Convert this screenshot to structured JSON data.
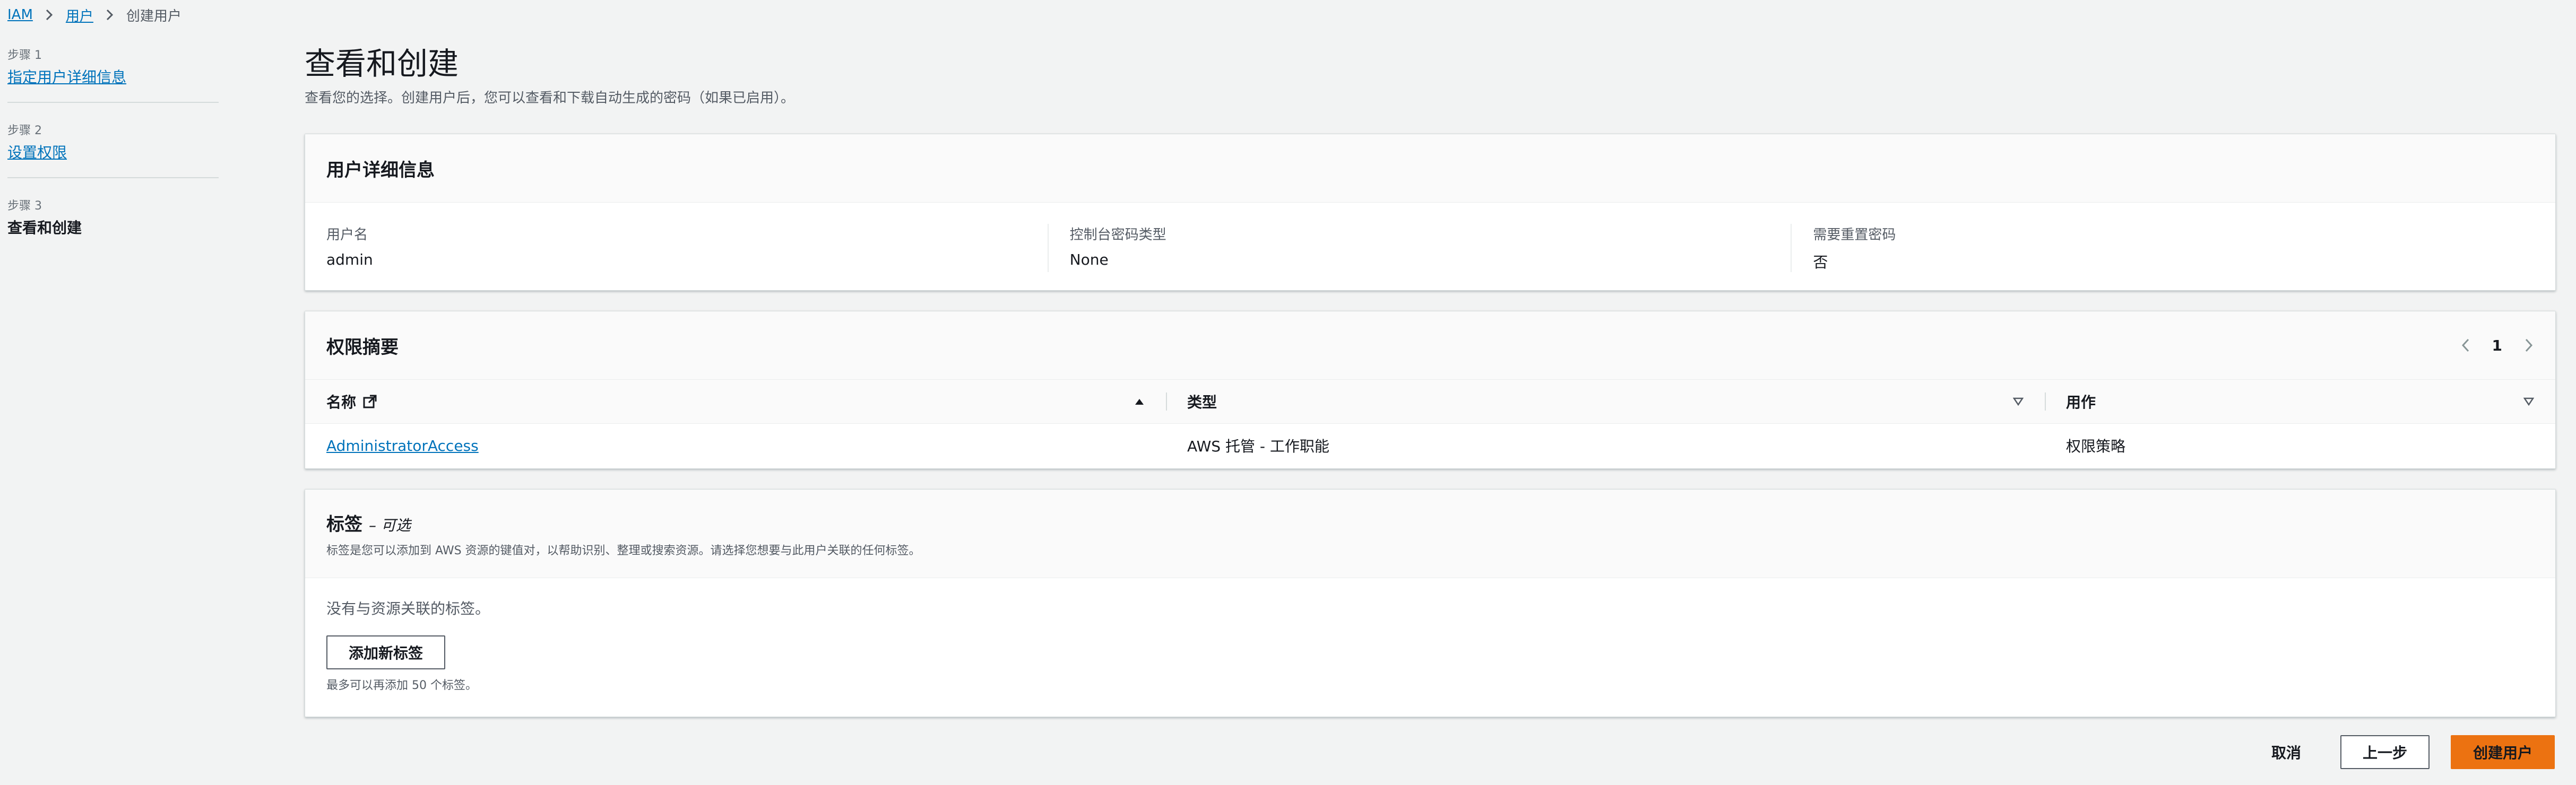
{
  "breadcrumb": {
    "root": "IAM",
    "parent": "用户",
    "current": "创建用户"
  },
  "steps": [
    {
      "caption": "步骤 1",
      "label": "指定用户详细信息"
    },
    {
      "caption": "步骤 2",
      "label": "设置权限"
    },
    {
      "caption": "步骤 3",
      "label": "查看和创建"
    }
  ],
  "header": {
    "title": "查看和创建",
    "description": "查看您的选择。创建用户后，您可以查看和下载自动生成的密码（如果已启用）。"
  },
  "user_details": {
    "title": "用户详细信息",
    "fields": [
      {
        "label": "用户名",
        "value": "admin"
      },
      {
        "label": "控制台密码类型",
        "value": "None"
      },
      {
        "label": "需要重置密码",
        "value": "否"
      }
    ]
  },
  "permissions": {
    "title": "权限摘要",
    "page": "1",
    "columns": [
      "名称",
      "类型",
      "用作"
    ],
    "rows": [
      {
        "name": "AdministratorAccess",
        "type": "AWS 托管 - 工作职能",
        "used_as": "权限策略"
      }
    ]
  },
  "tags": {
    "title": "标签",
    "optional": "– 可选",
    "description": "标签是您可以添加到 AWS 资源的键值对，以帮助识别、整理或搜索资源。请选择您想要与此用户关联的任何标签。",
    "empty": "没有与资源关联的标签。",
    "add_button": "添加新标签",
    "hint": "最多可以再添加 50 个标签。"
  },
  "footer": {
    "cancel": "取消",
    "previous": "上一步",
    "create": "创建用户"
  },
  "colors": {
    "link": "#0073bb",
    "primary": "#ec7211",
    "background": "#f2f3f3"
  },
  "icons": {
    "breadcrumb_separator": "chevron-right-icon",
    "external_link": "external-link-icon",
    "sort_ascending": "caret-up-icon",
    "sort_unsorted": "caret-down-outline-icon",
    "pager_prev": "chevron-left-icon",
    "pager_next": "chevron-right-icon"
  }
}
